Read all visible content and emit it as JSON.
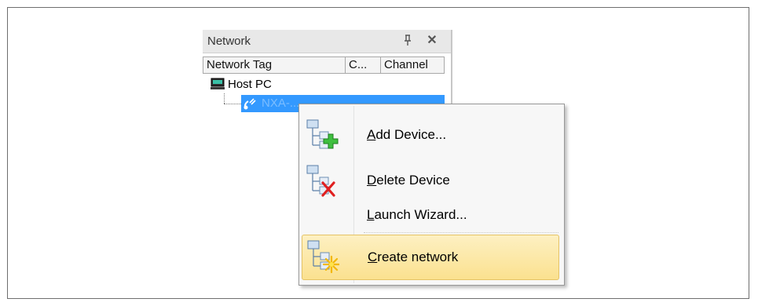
{
  "panel": {
    "title": "Network",
    "pin_glyph": "ᵖ",
    "close_glyph": "✕",
    "columns": [
      "Network Tag",
      "C...",
      "Channel"
    ],
    "tree": {
      "host_label": "Host PC",
      "device_label": "NXA-..."
    },
    "selection_color": "#3399ff"
  },
  "context_menu": {
    "items": [
      {
        "accel": "A",
        "rest": "dd Device...",
        "icon": "add-device-icon"
      },
      {
        "accel": "D",
        "rest": "elete Device",
        "icon": "delete-device-icon"
      },
      {
        "accel": "L",
        "rest": "aunch Wizard...",
        "icon": ""
      },
      {
        "accel": "C",
        "rest": "reate network",
        "icon": "create-network-icon",
        "highlighted": true
      }
    ],
    "highlight_color": "#fbe18f"
  }
}
